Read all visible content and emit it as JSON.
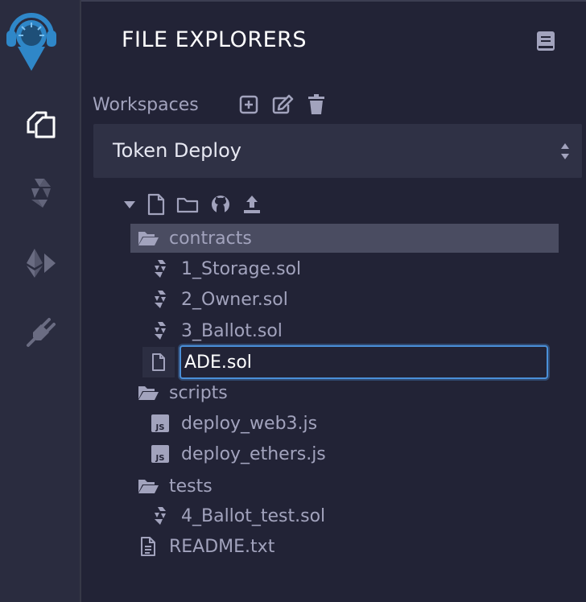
{
  "panel": {
    "title": "FILE EXPLORERS"
  },
  "workspaces": {
    "label": "Workspaces",
    "selected": "Token Deploy"
  },
  "tree": {
    "folders": [
      {
        "label": "contracts"
      },
      {
        "label": "scripts"
      },
      {
        "label": "tests"
      }
    ],
    "contracts_files": [
      "1_Storage.sol",
      "2_Owner.sol",
      "3_Ballot.sol"
    ],
    "new_file_value": "ADE.sol",
    "scripts_files": [
      "deploy_web3.js",
      "deploy_ethers.js"
    ],
    "tests_files": [
      "4_Ballot_test.sol"
    ],
    "root_files": [
      "README.txt"
    ]
  },
  "colors": {
    "background": "#222336",
    "rail": "#2a2c3f",
    "selected_row": "#4a4c61",
    "focus": "#4a8fd8",
    "logo": "#2f87c8"
  },
  "icons": {
    "rail": [
      "remix-logo-icon",
      "file-explorer-icon",
      "solidity-compiler-icon",
      "deploy-run-icon",
      "plugin-manager-icon"
    ],
    "workspace_actions": [
      "add-workspace-icon",
      "rename-workspace-icon",
      "delete-workspace-icon"
    ],
    "tree_actions": [
      "new-file-icon",
      "new-folder-icon",
      "github-icon",
      "upload-icon"
    ]
  }
}
